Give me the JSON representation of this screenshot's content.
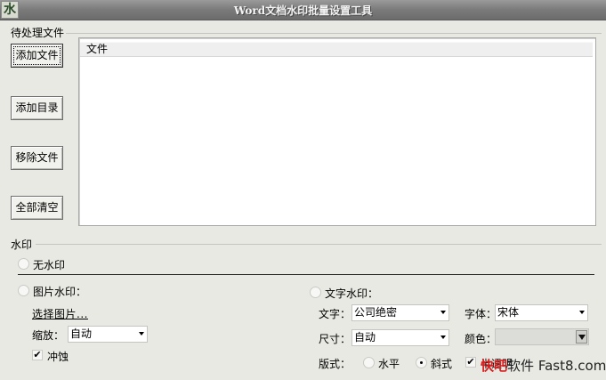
{
  "window": {
    "title": "Word文档水印批量设置工具",
    "icon_glyph": "水"
  },
  "files_group": {
    "label": "待处理文件",
    "buttons": {
      "add_file": "添加文件",
      "add_folder": "添加目录",
      "remove_file": "移除文件",
      "clear_all": "全部清空"
    },
    "list": {
      "column_header": "文件",
      "rows": []
    }
  },
  "watermark_group": {
    "label": "水印",
    "none": {
      "label": "无水印",
      "selected": false
    },
    "image": {
      "label": "图片水印：",
      "selected": false,
      "choose_image": "选择图片...",
      "scale_label": "缩放：",
      "scale_value": "自动",
      "washout_label": "冲蚀",
      "washout_checked": true,
      "check_mark": "✔"
    },
    "text": {
      "label": "文字水印：",
      "selected": false,
      "text_label": "文字：",
      "text_value": "公司绝密",
      "font_label": "字体：",
      "font_value": "宋体",
      "size_label": "尺寸：",
      "size_value": "自动",
      "color_label": "颜色：",
      "color_value": "#dcdcd8",
      "layout_label": "版式：",
      "layout_horizontal": "水平",
      "layout_diagonal": "斜式",
      "layout_selected": "斜式",
      "semi_transparent": "半透明",
      "semi_transparent_checked": true,
      "check_mark": "✔"
    }
  },
  "site_watermark": {
    "part1": "快吧",
    "part2": "软件",
    "part3": "Fast8.com"
  }
}
